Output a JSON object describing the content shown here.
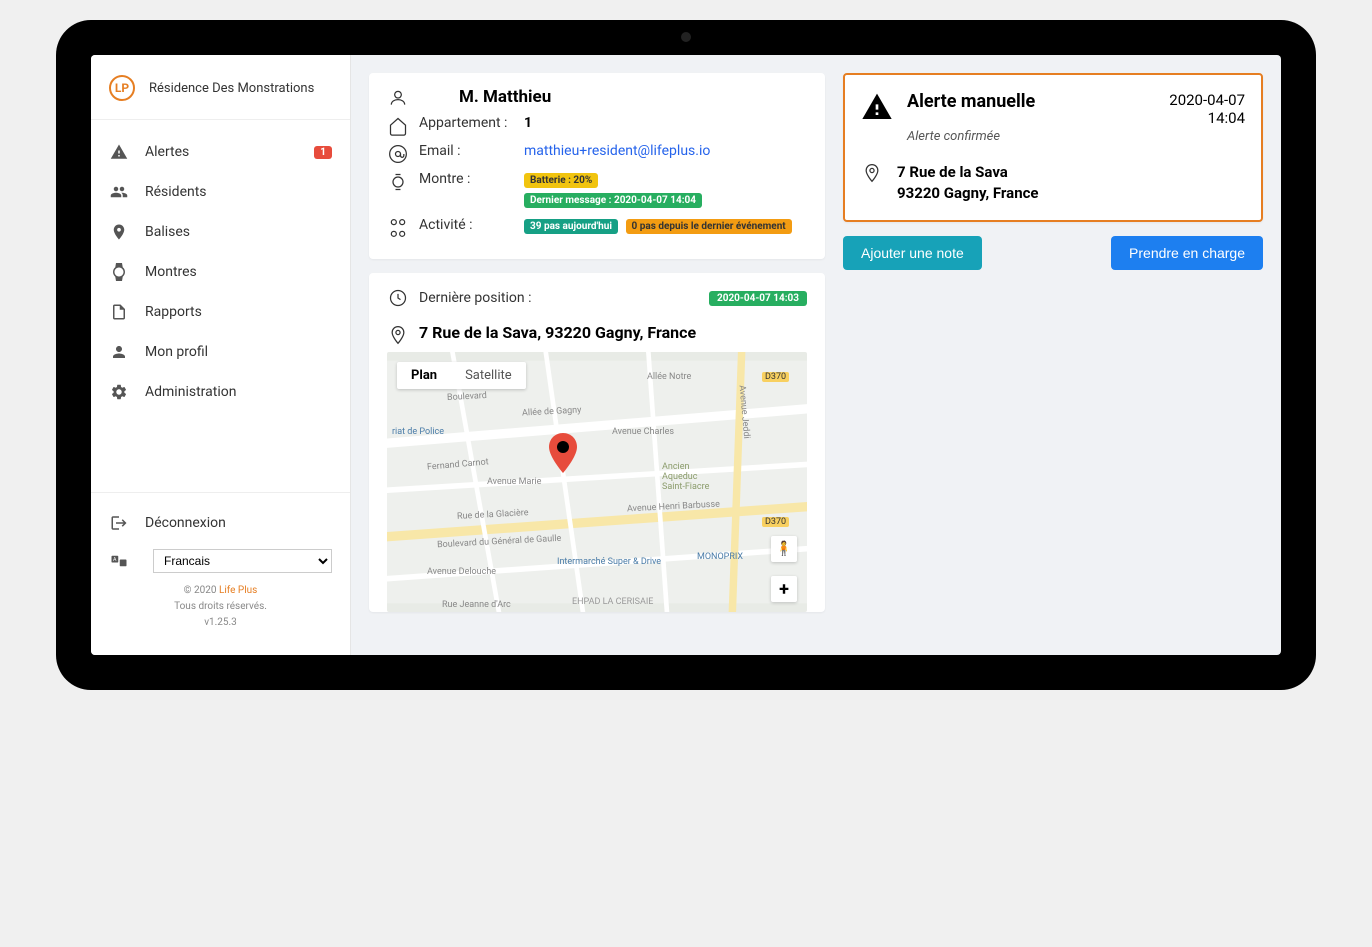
{
  "sidebar": {
    "title": "Résidence Des Monstrations",
    "items": [
      {
        "label": "Alertes",
        "badge": "1"
      },
      {
        "label": "Résidents"
      },
      {
        "label": "Balises"
      },
      {
        "label": "Montres"
      },
      {
        "label": "Rapports"
      },
      {
        "label": "Mon profil"
      },
      {
        "label": "Administration"
      }
    ],
    "logout": "Déconnexion",
    "language": "Francais",
    "copyright_prefix": "© 2020 ",
    "copyright_brand": "Life Plus",
    "rights": "Tous droits réservés.",
    "version": "v1.25.3"
  },
  "resident": {
    "name": "M. Matthieu",
    "apartment_label": "Appartement :",
    "apartment": "1",
    "email_label": "Email :",
    "email": "matthieu+resident@lifeplus.io",
    "watch_label": "Montre :",
    "battery": "Batterie : 20%",
    "last_message": "Dernier message : 2020-04-07 14:04",
    "activity_label": "Activité :",
    "steps_today": "39 pas aujourd'hui",
    "steps_since": "0 pas depuis le dernier événement"
  },
  "position": {
    "label": "Dernière position :",
    "timestamp": "2020-04-07 14:03",
    "address": "7 Rue de la Sava, 93220 Gagny, France"
  },
  "map": {
    "tab_plan": "Plan",
    "tab_satellite": "Satellite",
    "labels": {
      "road1": "Boulevard",
      "road2": "Allée de Gagny",
      "road3": "Avenue Marie",
      "road4": "Avenue Charles",
      "road5": "Avenue Henri Barbusse",
      "road6": "Boulevard du Général de Gaulle",
      "road7": "Rue de la Glacière",
      "road8": "Allée Notre",
      "road9": "Avenue Delouche",
      "road10": "Rue Jeanne d'Arc",
      "road11": "Avenue Jeddi",
      "road12": "Fernand Carnot",
      "poi1": "riat de Police",
      "poi2": "Intermarché Super & Drive",
      "poi3": "MONOPRIX",
      "poi4": "EHPAD LA CERISAIE",
      "poi5": "Ancien Aqueduc Saint-Fiacre",
      "hwy1": "D370",
      "hwy2": "D370"
    }
  },
  "alert": {
    "title": "Alerte manuelle",
    "date": "2020-04-07",
    "time": "14:04",
    "status": "Alerte confirmée",
    "address_line1": "7 Rue de la Sava",
    "address_line2": "93220 Gagny, France"
  },
  "buttons": {
    "add_note": "Ajouter une note",
    "take_charge": "Prendre en charge"
  }
}
